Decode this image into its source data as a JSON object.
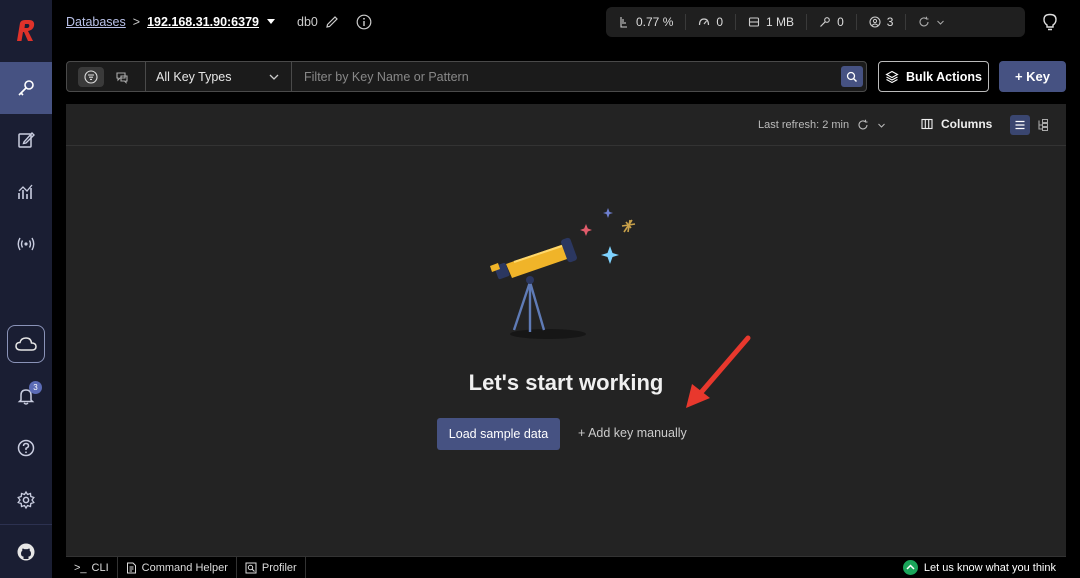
{
  "breadcrumb": {
    "databases": "Databases",
    "separator": ">",
    "host": "192.168.31.90:6379",
    "db": "db0"
  },
  "stats": [
    {
      "icon": "cpu-icon",
      "value": "0.77 %"
    },
    {
      "icon": "gauge-icon",
      "value": "0"
    },
    {
      "icon": "memory-icon",
      "value": "1 MB"
    },
    {
      "icon": "key-icon",
      "value": "0"
    },
    {
      "icon": "users-icon",
      "value": "3"
    }
  ],
  "filter": {
    "key_type": "All Key Types",
    "placeholder": "Filter by Key Name or Pattern"
  },
  "actions": {
    "bulk": "Bulk Actions",
    "add_key": "+ Key"
  },
  "panel": {
    "last_refresh_label": "Last refresh:",
    "last_refresh_value": "2 min",
    "columns": "Columns",
    "empty_title": "Let's start working",
    "load_sample": "Load sample data",
    "add_manually": "+ Add key manually"
  },
  "sidebar": {
    "notification_count": "3"
  },
  "bottombar": {
    "cli": "CLI",
    "cli_prefix": ">_",
    "command_helper": "Command Helper",
    "profiler": "Profiler",
    "feedback": "Let us know what you think"
  },
  "colors": {
    "accent": "#465282",
    "sidebar": "#1a1e33",
    "panel": "#232323",
    "brand_red": "#e0322a",
    "arrow_red": "#e8382d"
  }
}
